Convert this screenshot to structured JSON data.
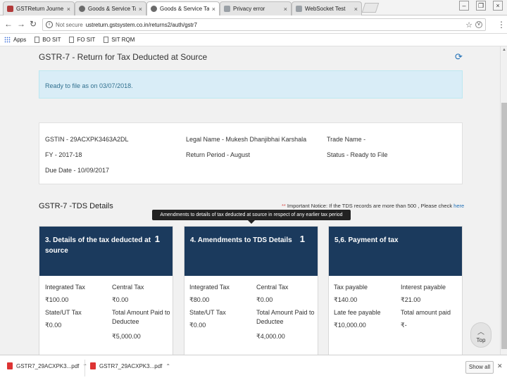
{
  "browser": {
    "tabs": [
      {
        "title": "GSTReturn Journe - Aq",
        "active": false
      },
      {
        "title": "Goods & Service Tax (G",
        "active": false
      },
      {
        "title": "Goods & Service Tax (GS",
        "active": true
      },
      {
        "title": "Privacy error",
        "active": false
      },
      {
        "title": "WebSocket Test",
        "active": false
      }
    ],
    "tab_close": "×",
    "window_controls": [
      "–",
      "❐",
      "×"
    ],
    "security_label": "Not secure",
    "url": "ustreturn.gstsystem.co.in/returns2/auth/gstr7",
    "bookmarks": [
      "Apps",
      "BO SIT",
      "FO SIT",
      "SIT RQM"
    ]
  },
  "page": {
    "title": "GSTR-7 - Return for Tax Deducted at Source",
    "alert": "Ready to file as on 03/07/2018.",
    "info": {
      "gstin": "GSTIN - 29ACXPK3463A2DL",
      "legal_name": "Legal Name - Mukesh Dhanjibhai Karshala",
      "trade_name": "Trade Name -",
      "fy": "FY - 2017-18",
      "return_period": "Return Period - August",
      "status": "Status - Ready to File",
      "due_date": "Due Date - 10/09/2017"
    },
    "section_title": "GSTR-7 -TDS Details",
    "notice": {
      "asterisk": "**",
      "text": " Important Notice: If the TDS records are more than 500 , Please check ",
      "link": "here"
    },
    "tooltip": "Amendments to details of tax deducted at source in respect of any earlier tax period",
    "tiles": [
      {
        "heading": "3. Details of the tax deducted at source",
        "count": "1",
        "labels": [
          "Integrated Tax",
          "Central Tax",
          "State/UT Tax",
          "Total Amount Paid to Deductee"
        ],
        "values": [
          "₹100.00",
          "₹0.00",
          "₹0.00",
          "₹5,000.00"
        ]
      },
      {
        "heading": "4. Amendments to TDS Details",
        "count": "1",
        "labels": [
          "Integrated Tax",
          "Central Tax",
          "State/UT Tax",
          "Total Amount Paid to Deductee"
        ],
        "values": [
          "₹80.00",
          "₹0.00",
          "₹0.00",
          "₹4,000.00"
        ]
      },
      {
        "heading": "5,6. Payment of tax",
        "count": "",
        "labels": [
          "Tax payable",
          "Interest payable",
          "Late fee payable",
          "Total amount paid"
        ],
        "values": [
          "₹140.00",
          "₹21.00",
          "₹10,000.00",
          "₹-"
        ]
      }
    ],
    "top_button": "Top"
  },
  "downloads": {
    "items": [
      "GSTR7_29ACXPK3...pdf",
      "GSTR7_29ACXPK3...pdf"
    ],
    "show_all": "Show all"
  },
  "colors": {
    "tile_header": "#1b3a5d",
    "alert_bg": "#d9edf7",
    "link": "#1f6fb6",
    "required": "#d9534f"
  }
}
